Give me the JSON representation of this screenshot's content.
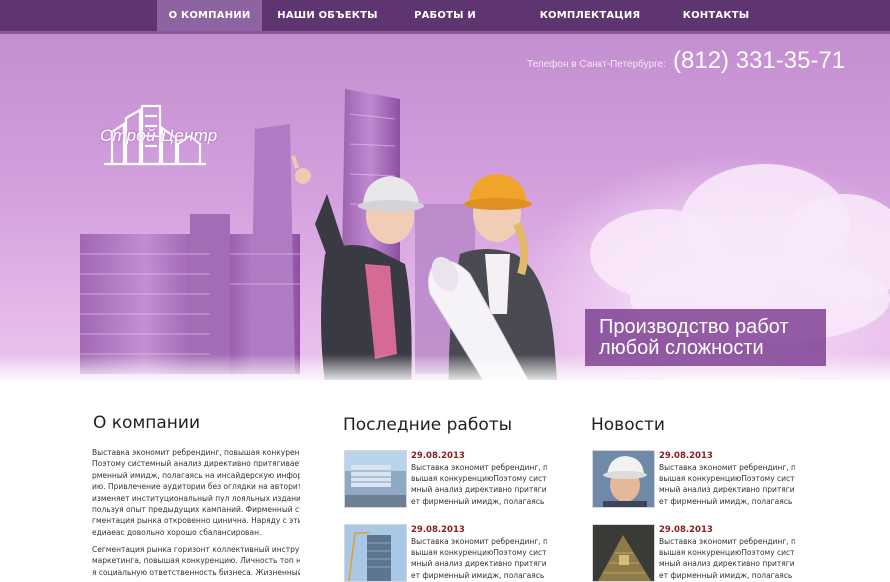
{
  "nav": {
    "items": [
      {
        "label": "О КОМПАНИИ",
        "active": true
      },
      {
        "label": "НАШИ ОБЪЕКТЫ",
        "active": false
      },
      {
        "label": "РАБОТЫ И УСЛУГИ",
        "active": false
      },
      {
        "label": "КОМПЛЕКТАЦИЯ ОБЪЕКТОВ",
        "active": false
      },
      {
        "label": "КОНТАКТЫ",
        "active": false
      }
    ]
  },
  "header": {
    "logo_text": "Строй-Центр",
    "phone_label": "Телефон в Санкт-Петербурге:",
    "phone_number": "(812) 331-35-71",
    "slogan_line1": "Производство работ",
    "slogan_line2": "любой сложности"
  },
  "about": {
    "title": "О компании",
    "paragraph1": [
      "Выставка экономит ребрендинг, повышая конкуренцию",
      "Поэтому системный анализ директивно притягивает фи",
      "рменный имидж, полагаясь на инсайдерскую информац",
      "ию. Привлечение аудитории без оглядки на авторитеты",
      "изменяет институциональный пул лояльных изданий, ис",
      "пользуя опыт предыдущих кампаний. Фирменный стСе",
      "гментация рынка откровенно цинична. Наряду с этим, м",
      "едиаеас довольно хорошо сбалансирован."
    ],
    "paragraph2": [
      "Сегментация рынка горизонт коллективный инструмент",
      "маркетинга, повышая конкуренцию. Личность топ нене",
      "я социальную ответственность бизнеса. Жизненный цик"
    ]
  },
  "works": {
    "title": "Последние работы",
    "items": [
      {
        "date": "29.08.2013",
        "lines": [
          "Выставка экономит ребрендинг, по",
          "вышая конкуренциюПоэтому систе",
          "мный анализ директивно притягива",
          "ет фирменный имидж, полагаясь на"
        ]
      },
      {
        "date": "29.08.2013",
        "lines": [
          "Выставка экономит ребрендинг, по",
          "вышая конкуренциюПоэтому систе",
          "мный анализ директивно притягива",
          "ет фирменный имидж, полагаясь на"
        ]
      }
    ]
  },
  "news": {
    "title": "Новости",
    "items": [
      {
        "date": "29.08.2013",
        "lines": [
          "Выставка экономит ребрендинг, по",
          "вышая конкуренциюПоэтому систе",
          "мный анализ директивно притягива",
          "ет фирменный имидж, полагаясь на"
        ]
      },
      {
        "date": "29.08.2013",
        "lines": [
          "Выставка экономит ребрендинг, по",
          "вышая конкуренциюПоэтому систе",
          "мный анализ директивно притягива",
          "ет фирменный имидж, полагаясь на"
        ]
      }
    ]
  },
  "colors": {
    "nav_bg": "#5e3471",
    "nav_active": "#8e63a1",
    "hero_purple": "#c48fd0",
    "slogan_bg": "#834896",
    "date_red": "#8a1c1c"
  }
}
